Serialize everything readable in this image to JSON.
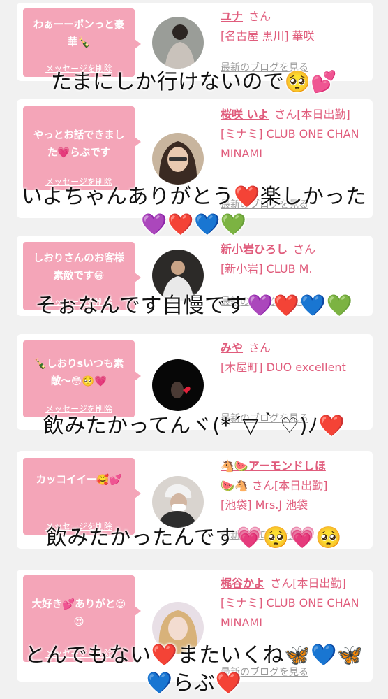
{
  "cards": [
    {
      "message": "わぁーーポンっと豪華🍾",
      "delete_label": "メッセージを削除",
      "name": "ユナ",
      "san": "さん",
      "shop": "[名古屋 黒川] 華咲",
      "blog": "最新のブログを見る"
    },
    {
      "message": "やっとお話できました💗らぶです",
      "delete_label": "メッセージを削除",
      "name": "桜咲 いよ",
      "san": "さん[本日出勤]",
      "shop": "[ミナミ] CLUB ONE CHAN MINAMI",
      "blog": "最新のブログを見る"
    },
    {
      "message": "しおりさんのお客様素敵です😁",
      "delete_label": "メッセージを削除",
      "name": "新小岩ひろし",
      "san": "さん",
      "shop": "[新小岩] CLUB M.",
      "blog": "最新のブログを見る"
    },
    {
      "message": "🍾しおりsいつも素敵〜😳🥺💗",
      "delete_label": "メッセージを削除",
      "name": "みや",
      "san": "さん",
      "shop": "[木屋町] DUO excellent",
      "blog": "最新のブログを見る"
    },
    {
      "message": "カッコイイー🥰💕",
      "delete_label": "メッセージを削除",
      "name": "🐴🍉アーモンドしほ",
      "san": "🍉🐴 さん[本日出勤]",
      "shop": "[池袋] Mrs.J 池袋",
      "blog": "最新のブログを見る"
    },
    {
      "message": "大好き💕ありがと😍😍",
      "delete_label": "メッセージを削除",
      "name": "梶谷かよ",
      "san": "さん[本日出勤]",
      "shop": "[ミナミ] CLUB ONE CHAN MINAMI",
      "blog": "最新のブログを見る"
    }
  ],
  "captions": [
    "たまにしか行けないので🥺💕",
    "いよちゃんありがとう❤️楽しかった💜❤️💙💚",
    "そぉなんです自慢です💜❤️💙💚",
    "飲みたかってんヾ(*´▽｀♡)ﾉ❤️",
    "飲みたかったんです💗🥺💗🥺",
    "とんでもない❤️またいくね🦋💙🦋💙らぶ❤️"
  ],
  "colors": {
    "bubble": "#f4a5b8",
    "accent": "#e05c7c",
    "muted": "#9a9a9a"
  }
}
